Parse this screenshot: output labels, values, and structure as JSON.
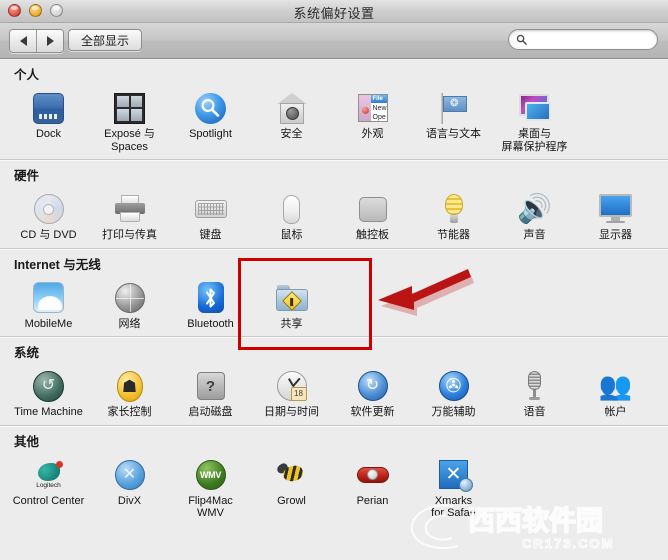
{
  "window": {
    "title": "系统偏好设置",
    "traffic_lights": [
      "close",
      "minimize",
      "zoom"
    ]
  },
  "toolbar": {
    "back_label": "◀",
    "forward_label": "▶",
    "show_all_label": "全部显示",
    "search": {
      "value": "",
      "placeholder": "",
      "icon": "search-icon"
    }
  },
  "sections": [
    {
      "id": "personal",
      "title": "个人",
      "items": [
        {
          "label": "Dock",
          "icon": "dock-icon"
        },
        {
          "label": "Exposé 与\nSpaces",
          "icon": "expose-spaces-icon"
        },
        {
          "label": "Spotlight",
          "icon": "spotlight-icon"
        },
        {
          "label": "安全",
          "icon": "security-icon"
        },
        {
          "label": "外观",
          "icon": "appearance-icon"
        },
        {
          "label": "语言与文本",
          "icon": "language-text-icon"
        },
        {
          "label": "桌面与\n屏幕保护程序",
          "icon": "desktop-screensaver-icon"
        }
      ]
    },
    {
      "id": "hardware",
      "title": "硬件",
      "items": [
        {
          "label": "CD 与 DVD",
          "icon": "cd-dvd-icon"
        },
        {
          "label": "打印与传真",
          "icon": "print-fax-icon"
        },
        {
          "label": "键盘",
          "icon": "keyboard-icon"
        },
        {
          "label": "鼠标",
          "icon": "mouse-icon"
        },
        {
          "label": "触控板",
          "icon": "trackpad-icon"
        },
        {
          "label": "节能器",
          "icon": "energy-saver-icon"
        },
        {
          "label": "声音",
          "icon": "sound-icon"
        },
        {
          "label": "显示器",
          "icon": "displays-icon"
        }
      ]
    },
    {
      "id": "internet",
      "title": "Internet 与无线",
      "items": [
        {
          "label": "MobileMe",
          "icon": "mobileme-icon"
        },
        {
          "label": "网络",
          "icon": "network-icon"
        },
        {
          "label": "Bluetooth",
          "icon": "bluetooth-icon"
        },
        {
          "label": "共享",
          "icon": "sharing-folder-icon"
        }
      ]
    },
    {
      "id": "system",
      "title": "系统",
      "items": [
        {
          "label": "Time Machine",
          "icon": "time-machine-icon"
        },
        {
          "label": "家长控制",
          "icon": "parental-controls-icon"
        },
        {
          "label": "启动磁盘",
          "icon": "startup-disk-icon"
        },
        {
          "label": "日期与时间",
          "icon": "date-time-icon"
        },
        {
          "label": "软件更新",
          "icon": "software-update-icon"
        },
        {
          "label": "万能辅助",
          "icon": "universal-access-icon"
        },
        {
          "label": "语音",
          "icon": "speech-icon"
        },
        {
          "label": "帐户",
          "icon": "accounts-icon"
        }
      ]
    },
    {
      "id": "other",
      "title": "其他",
      "items": [
        {
          "label": "Control Center",
          "icon": "logitech-control-center-icon"
        },
        {
          "label": "DivX",
          "icon": "divx-icon"
        },
        {
          "label": "Flip4Mac\nWMV",
          "icon": "flip4mac-wmv-icon"
        },
        {
          "label": "Growl",
          "icon": "growl-icon"
        },
        {
          "label": "Perian",
          "icon": "perian-icon"
        },
        {
          "label": "Xmarks\nfor Safari",
          "icon": "xmarks-safari-icon"
        }
      ]
    }
  ],
  "annotation": {
    "highlight_target": "共享",
    "box_color": "#cc0000",
    "arrow_color": "#bb1414",
    "arrow_direction": "points-left"
  },
  "watermark": {
    "text": "西西软件园",
    "url": "CR173.COM"
  },
  "icon_sublabels": {
    "logitech": "Logitech",
    "wmv": "WMV",
    "appearance_menu_title": "File",
    "appearance_item1": "New",
    "appearance_item2": "Ope",
    "calendar_day": "18",
    "startup_disk_mark": "?",
    "divx_mark": "✕",
    "xmarks_mark": "✕",
    "flag_mark": "❂",
    "update_mark": "↻",
    "access_mark": "✇",
    "time_machine_mark": "↺",
    "parental_mark": "☗"
  }
}
